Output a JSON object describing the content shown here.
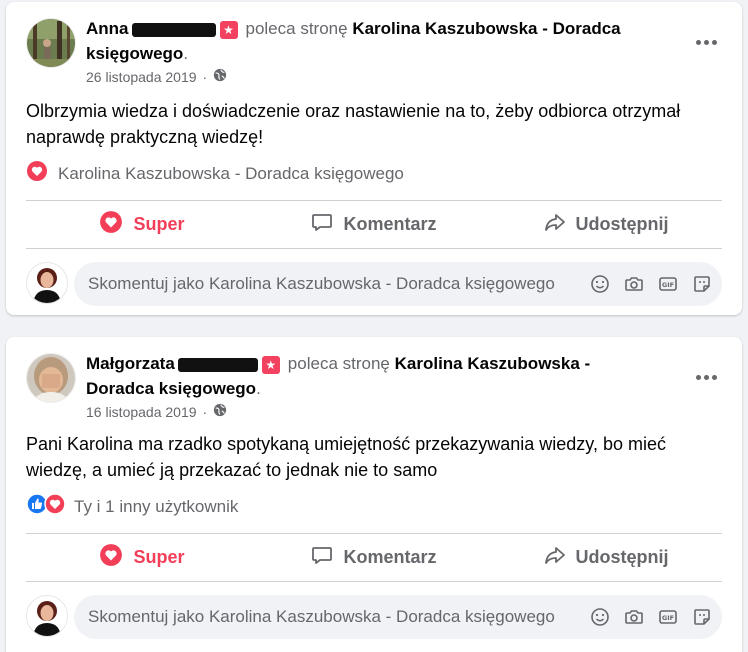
{
  "posts": [
    {
      "author": "Anna",
      "recommends_text": "poleca stronę",
      "page_name": "Karolina Kaszubowska - Doradca księgowego",
      "period": ".",
      "date": "26 listopada 2019",
      "dot": "·",
      "text": "Olbrzymia wiedza i doświadczenie oraz nastawienie na to, żeby odbiorca otrzymał naprawdę praktyczną wiedzę!",
      "reactions_text": "Karolina Kaszubowska - Doradca księgowego",
      "actions": {
        "like": "Super",
        "comment": "Komentarz",
        "share": "Udostępnij"
      },
      "comment_placeholder": "Skomentuj jako Karolina Kaszubowska - Doradca księgowego"
    },
    {
      "author": "Małgorzata",
      "recommends_text": "poleca stronę",
      "page_name": "Karolina Kaszubowska - Doradca księgowego",
      "period": ".",
      "date": "16 listopada 2019",
      "dot": "·",
      "text": "Pani Karolina ma rzadko spotykaną umiejętność przekazywania wiedzy, bo mieć wiedzę, a umieć ją przekazać to jednak nie to samo",
      "reactions_text": "Ty i 1 inny użytkownik",
      "actions": {
        "like": "Super",
        "comment": "Komentarz",
        "share": "Udostępnij"
      },
      "comment_placeholder": "Skomentuj jako Karolina Kaszubowska - Doradca księgowego"
    }
  ],
  "colors": {
    "love": "#f33e58",
    "like_blue": "#1877f2",
    "muted": "#65676b",
    "bg": "#f0f2f5"
  },
  "icons": [
    "globe-icon",
    "more-icon",
    "heart-icon",
    "comment-icon",
    "share-icon",
    "emoji-icon",
    "camera-icon",
    "gif-icon",
    "sticker-icon",
    "recommend-badge-icon"
  ]
}
